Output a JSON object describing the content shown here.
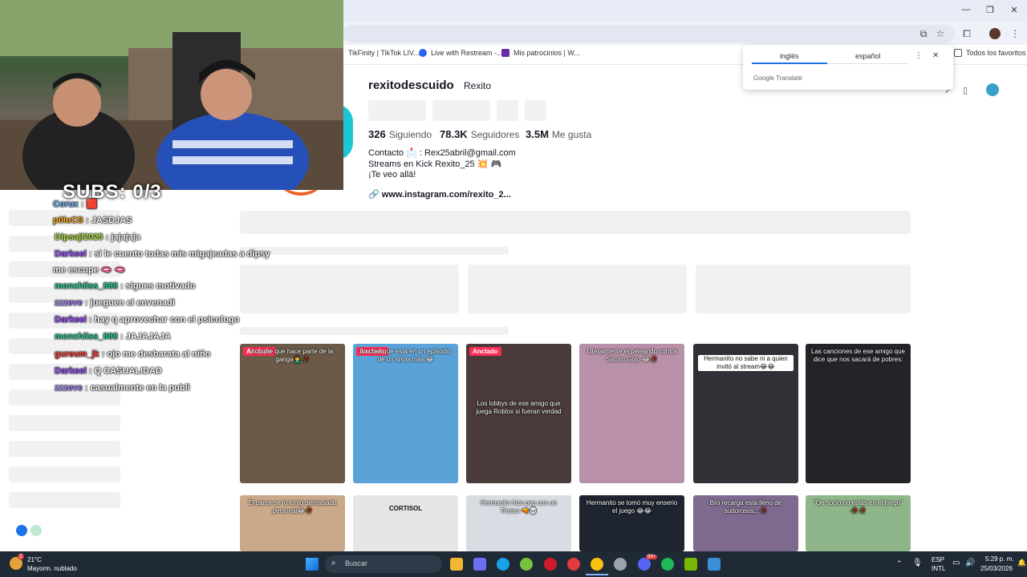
{
  "bookmarks": [
    {
      "label": "TikFinity | TikTok LIV...",
      "color": "#111111"
    },
    {
      "label": "Live with Restream -...",
      "color": "#2a62f0"
    },
    {
      "label": "Mis patrocinios | W...",
      "color": "#6a2aa8"
    },
    {
      "label": "Todos los favoritos",
      "color": "#555555"
    }
  ],
  "translate": {
    "tab_from": "inglés",
    "tab_to": "español",
    "brand_google": "Google",
    "brand_translate": "Translate"
  },
  "profile": {
    "handle": "rexitodescuido",
    "nickname": "Rexito",
    "following_count": "326",
    "following_label": "Siguiendo",
    "followers_count": "78.3K",
    "followers_label": "Seguidores",
    "likes_count": "3.5M",
    "likes_label": "Me gusta",
    "bio_line1": "Contacto 📩 : Rex25abril@gmail.com",
    "bio_line2": "Streams en Kick Rexito_25 💥 🎮",
    "bio_line3": "¡Te veo allá!",
    "link": "www.instagram.com/rexito_2..."
  },
  "stream_overlay": {
    "subs": "SUBS: 0/3"
  },
  "chat": [
    {
      "user": "Corux",
      "text": ": 🟥",
      "color": "#6fb7ff"
    },
    {
      "user": "p0luCS",
      "text": ": JASDJAS",
      "color": "#ffb020"
    },
    {
      "user": "Dipsajl2025",
      "text": ": jajajaja",
      "color": "#b7e34b"
    },
    {
      "user": "Darkeel",
      "text": ": si le cuento todas mis migajeadas a dipsy",
      "color": "#9b59ff"
    },
    {
      "user": "",
      "text": "me escupe 🫦 🫦",
      "color": "#ffffff"
    },
    {
      "user": "monchiiss_888",
      "text": ": sigues motivado",
      "color": "#33d1a0"
    },
    {
      "user": "zzzeve",
      "text": ": jueguen el envenadi",
      "color": "#a98bff"
    },
    {
      "user": "Darkeel",
      "text": ": hay q aprovechar con el psicologo",
      "color": "#9b59ff"
    },
    {
      "user": "monchiiss_888",
      "text": ": JAJAJAJA",
      "color": "#33d1a0"
    },
    {
      "user": "gureum_jk",
      "text": ": ojo me desbarata al niño",
      "color": "#ff4b4b"
    },
    {
      "user": "Darkeel",
      "text": ": Q CASUALIDAD",
      "color": "#9b59ff"
    },
    {
      "user": "zzzeve",
      "text": ": casualmente en la publi",
      "color": "#a98bff"
    }
  ],
  "videos_row1": [
    {
      "badge": "Anclado",
      "caption": "ito cree que hace parte de la ganga🤦‍♂️🥀",
      "bg": "#6b5a48"
    },
    {
      "badge": "Anclado",
      "caption": "ito cree que está en un episodio de un show más 😂",
      "bg": "#5aa2d8"
    },
    {
      "badge": "Anclado",
      "caption": "Los lobbys de ese amigo que juega Roblox si fueran verdad",
      "bg": "#4a3a3a"
    },
    {
      "badge": "",
      "caption": "Literalmente él peleando contra Satoru Gojo 😂🥀",
      "bg": "#b890a8"
    },
    {
      "badge": "",
      "caption": "Hermanito no sabe ni a quien invitó al stream😂😂",
      "bg": "#2f3136"
    },
    {
      "badge": "",
      "caption": "Las canciones de ese amigo que dice que nos sacará de pobres:",
      "bg": "#222428"
    }
  ],
  "videos_row2": [
    {
      "caption": "El parce se lo tomó demasiado personal😂🥀",
      "bg": "#caa98a",
      "dark": false
    },
    {
      "caption": "CORTISOL",
      "bg": "#e6e6e6",
      "dark": true
    },
    {
      "caption": "Hermanito hizo pvp con un Theian 🔫💀",
      "bg": "#d9dde3",
      "dark": false
    },
    {
      "caption": "Hermanito se tomó muy enserio el juego 😂😂",
      "bg": "#1e2430",
      "dark": false
    },
    {
      "caption": "Bro recarga esta lleno de sudorosos...🥀",
      "bg": "#7d6a8e",
      "dark": false
    },
    {
      "caption": "\"Oe socio no estás en el juego\" 🥀🥀",
      "bg": "#8fb58a",
      "dark": false
    }
  ],
  "taskbar": {
    "weather_temp": "21°C",
    "weather_desc": "Mayorm. nublado",
    "weather_badge": "2",
    "search_placeholder": "Buscar",
    "lang_top": "ESP",
    "lang_bottom": "INTL",
    "time": "5:29 p. m.",
    "date": "25/03/2026",
    "discord_badge": "99+"
  }
}
